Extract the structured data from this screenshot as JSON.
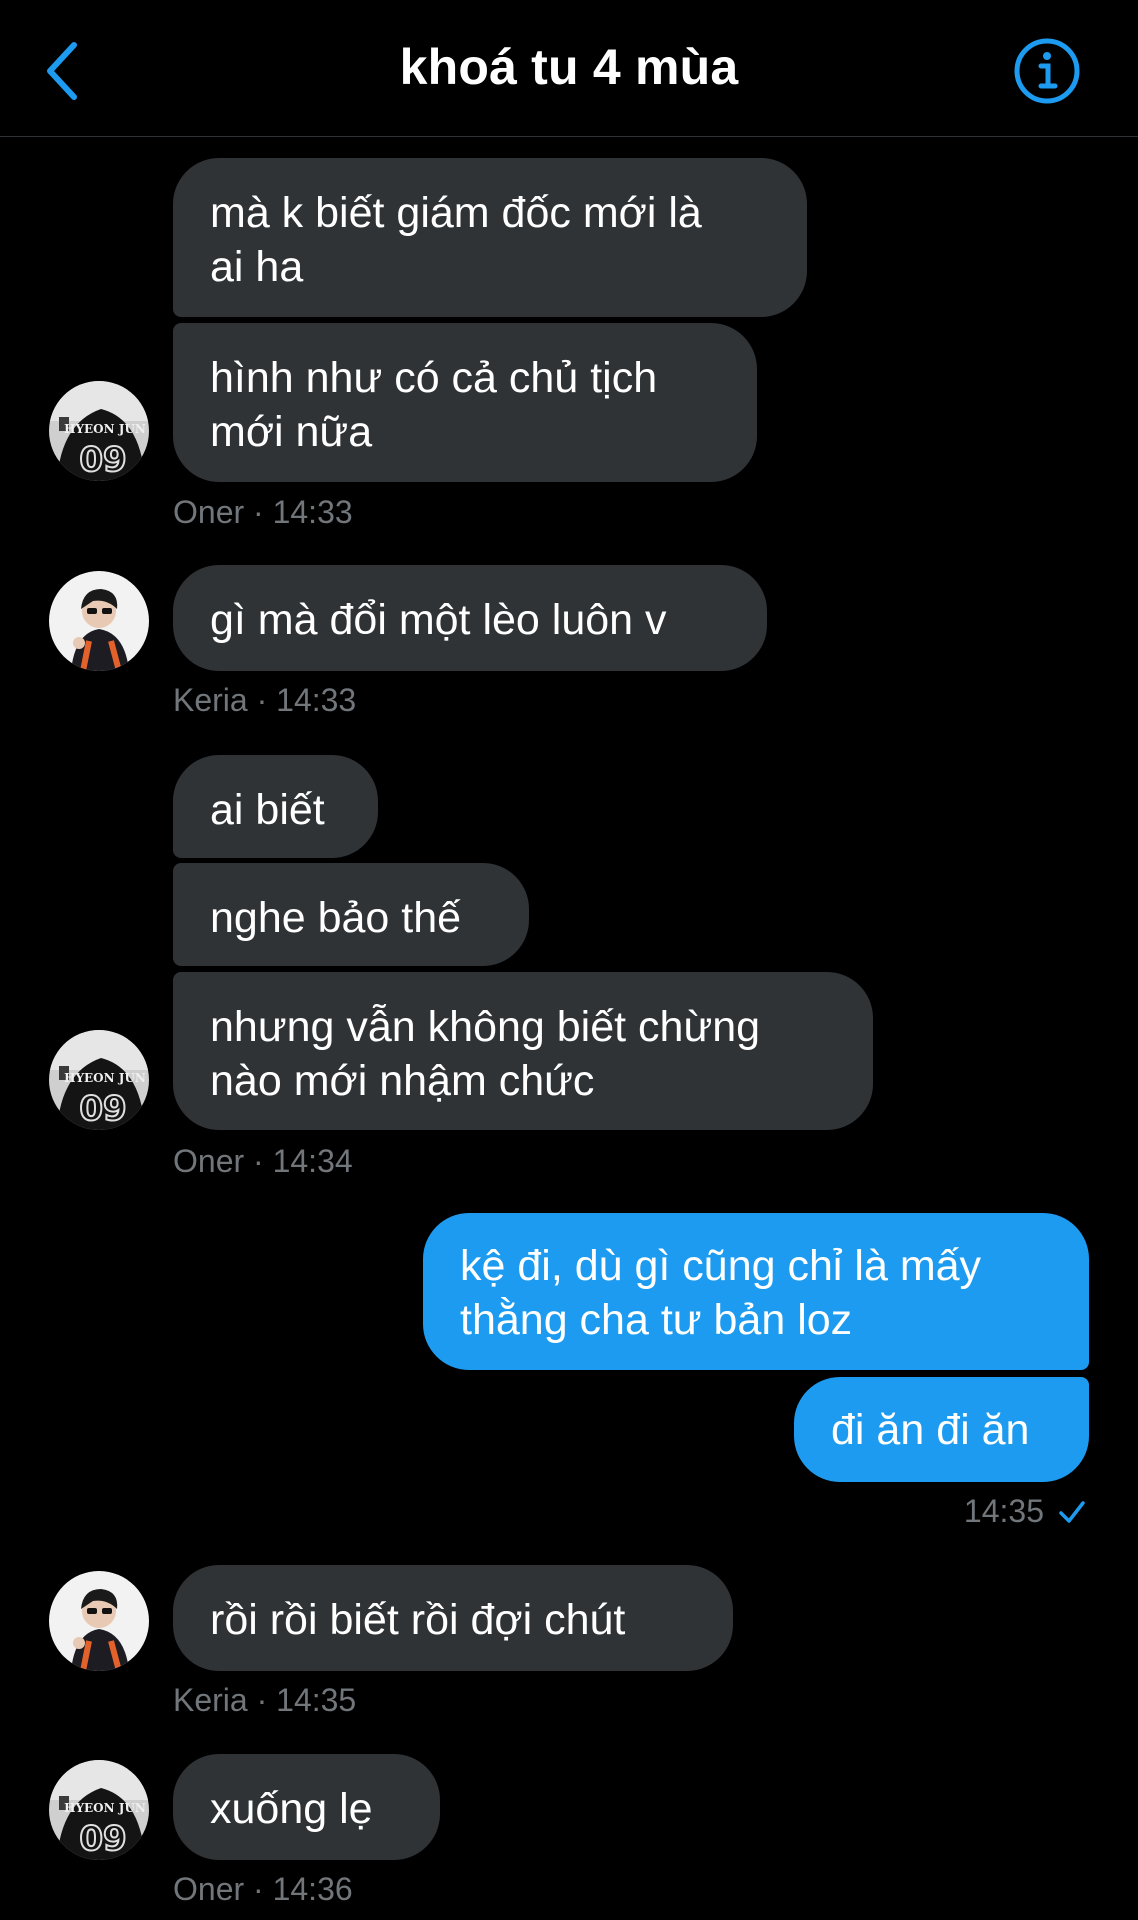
{
  "header": {
    "title": "khoá tu 4 mùa",
    "back_icon": "chevron-left-icon",
    "info_icon": "info-circle-icon",
    "accent_color": "#1d9bf0"
  },
  "messages": [
    {
      "text": "mà k biết giám đốc mới là\nai ha"
    },
    {
      "text": "hình như có cả chủ tịch\nmới nữa"
    },
    {
      "meta": "Oner · 14:33"
    },
    {
      "text": "gì mà đổi một lèo luôn v"
    },
    {
      "meta": "Keria · 14:33"
    },
    {
      "text": "ai biết"
    },
    {
      "text": "nghe bảo thế"
    },
    {
      "text": "nhưng vẫn không biết chừng\nnào mới nhậm chức"
    },
    {
      "meta": "Oner · 14:34"
    },
    {
      "text": "kệ đi, dù gì cũng chỉ là mấy\nthằng cha tư bản loz"
    },
    {
      "text": "đi ăn đi ăn"
    },
    {
      "meta": "14:35"
    },
    {
      "text": "rồi rồi biết rồi đợi chút"
    },
    {
      "meta": "Keria · 14:35"
    },
    {
      "text": "xuống lẹ"
    },
    {
      "meta": "Oner · 14:36"
    }
  ],
  "avatars": {
    "oner_jersey_text": "HYEON JUN",
    "oner_jersey_number": "09"
  },
  "colors": {
    "incoming_bubble": "#2f3336",
    "outgoing_bubble": "#1d9bf0",
    "meta_text": "#71767b"
  }
}
